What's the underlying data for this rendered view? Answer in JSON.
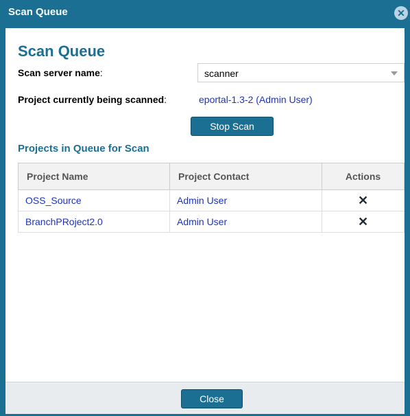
{
  "dialog": {
    "title": "Scan Queue",
    "close_icon": "close-circle-icon"
  },
  "main": {
    "heading": "Scan Queue",
    "server_label": "Scan server name",
    "server_colon": ":",
    "server_value": "scanner",
    "current_label": "Project currently being scanned",
    "current_colon": ":",
    "current_project": "eportal-1.3-2 (Admin User)",
    "stop_button": "Stop Scan",
    "queue_heading": "Projects in Queue for Scan"
  },
  "table": {
    "columns": [
      "Project Name",
      "Project Contact",
      "Actions"
    ],
    "rows": [
      {
        "project": "OSS_Source",
        "contact": "Admin User",
        "action_icon": "remove-x-icon"
      },
      {
        "project": "BranchPRoject2.0",
        "contact": "Admin User",
        "action_icon": "remove-x-icon"
      }
    ]
  },
  "footer": {
    "close_button": "Close"
  },
  "colors": {
    "accent": "#1a6f93",
    "link": "#1b33c5"
  }
}
